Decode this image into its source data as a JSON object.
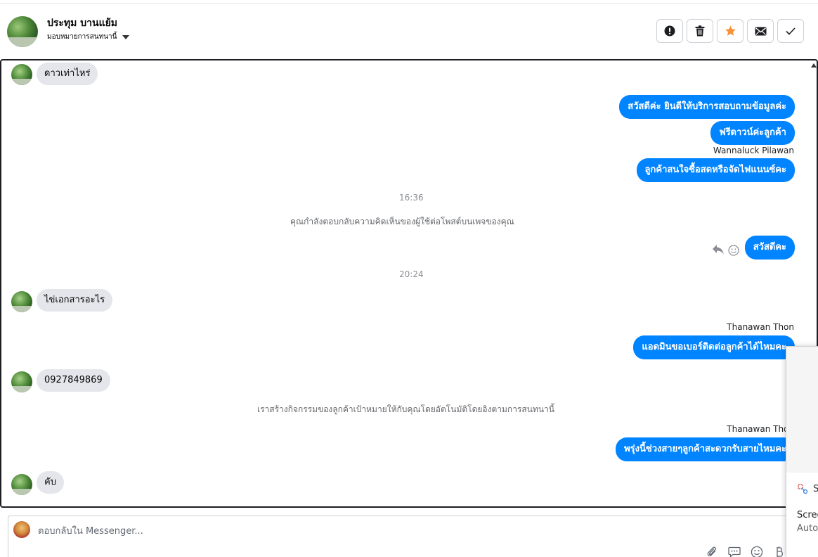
{
  "header": {
    "contact_name": "ประทุม บานแย้ม",
    "assign_label": "มอบหมายการสนทนานี้",
    "actions": [
      "spam",
      "delete",
      "follow-up",
      "mark-unread",
      "done"
    ]
  },
  "conversation": {
    "messages": [
      {
        "kind": "incoming",
        "text": "ดาวเท่าไหร่"
      },
      {
        "kind": "outgoing",
        "text": "สวัสดีค่ะ  ยินดีให้บริการสอบถามข้อมูลค่ะ"
      },
      {
        "kind": "outgoing",
        "text": "ฟรีดาวน์ค่ะลูกค้า"
      },
      {
        "kind": "sender",
        "text": "Wannaluck Pilawan"
      },
      {
        "kind": "outgoing",
        "text": "ลูกค้าสนใจซื้อสดหรือจัดไฟแนนซ์คะ"
      },
      {
        "kind": "time",
        "text": "16:36"
      },
      {
        "kind": "notice",
        "text": "คุณกำลังตอบกลับความคิดเห็นของผู้ใช้ต่อโพสต์บนเพจของคุณ"
      },
      {
        "kind": "outgoing",
        "text": "สวัสดีคะ"
      },
      {
        "kind": "time",
        "text": "20:24"
      },
      {
        "kind": "incoming",
        "text": "ไข่เอกสารอะไร"
      },
      {
        "kind": "sender",
        "text": "Thanawan Thon"
      },
      {
        "kind": "outgoing",
        "text": "แอดมินขอเบอร์ติดต่อลูกค้าได้ไหมคะ"
      },
      {
        "kind": "incoming",
        "text": "0927849869"
      },
      {
        "kind": "notice",
        "text": "เราสร้างกิจกรรมของลูกค้าเป้าหมายให้กับคุณโดยอัตโนมัติโดยอิงตามการสนทนานี้"
      },
      {
        "kind": "sender",
        "text": "Thanawan Thon"
      },
      {
        "kind": "outgoing",
        "text": "พรุ่งนี้ช่วงสายๆลูกค้าสะดวกรับสายไหมคะ"
      },
      {
        "kind": "incoming",
        "text": "คับ"
      }
    ]
  },
  "reply": {
    "placeholder": "ตอบกลับใน Messenger...",
    "tools": [
      "attach-icon",
      "saved-reply-icon",
      "emoji-icon",
      "payment-icon"
    ]
  },
  "popup": {
    "partial_icon_text": "S",
    "line1": "Scree",
    "line2": "Auto"
  },
  "colors": {
    "outgoing_bubble": "#0084ff",
    "incoming_bubble": "#e4e6eb",
    "follow_up_star": "#f7923a"
  }
}
